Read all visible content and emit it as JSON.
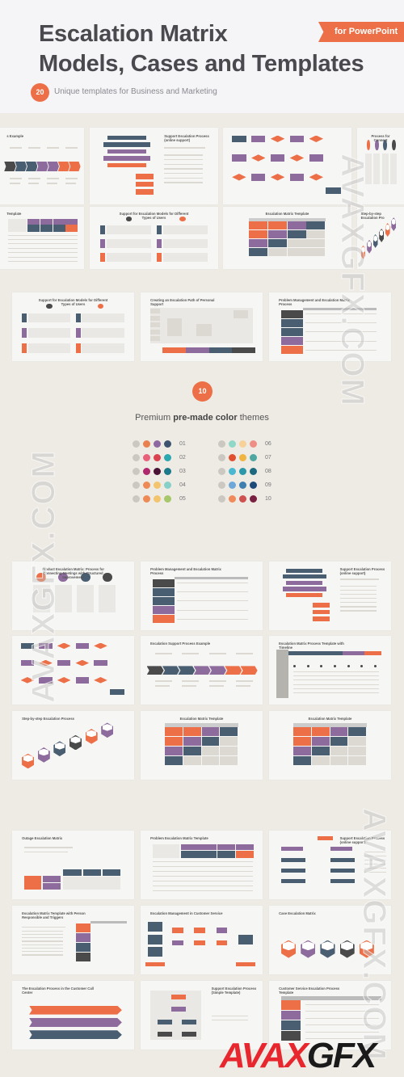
{
  "header": {
    "title_line1": "Escalation Matrix",
    "title_line2": "Models, Cases and Templates",
    "ribbon": "for PowerPoint",
    "count": "20",
    "subtitle": "Unique templates for Business and Marketing"
  },
  "colors": {
    "accent": "#ec6f47",
    "purple": "#8d6b9c",
    "navy": "#4a5e72",
    "dark": "#4a4a4a",
    "gray": "#d9d6cf",
    "background": "#eeebe5"
  },
  "top_strip": [
    "s Example",
    "Support Escalation Process (online support)",
    "",
    "Process for Connect",
    "Template",
    "Support for Escalation Models for Different Types of Users",
    "Escalation Matrix Template",
    "Step-by-step Escalation Pro"
  ],
  "row_three": [
    "Support for Escalation Models for Different Types of Users",
    "Creating an Escalation Path of Personal Support",
    "Problem Management and Escalation Matrix Process"
  ],
  "themes": {
    "count": "10",
    "title_pre": "Premium ",
    "title_bold": "pre-made color",
    "title_post": " themes",
    "items": [
      {
        "label": "01",
        "colors": [
          "#cbc8c2",
          "#e8804f",
          "#8e68a0",
          "#3d5370"
        ]
      },
      {
        "label": "02",
        "colors": [
          "#cbc8c2",
          "#e8607a",
          "#d9424e",
          "#2aa8b0"
        ]
      },
      {
        "label": "03",
        "colors": [
          "#cbc8c2",
          "#b0286e",
          "#4a1235",
          "#1d7a8a"
        ]
      },
      {
        "label": "04",
        "colors": [
          "#cbc8c2",
          "#ee8a55",
          "#f3c46e",
          "#86d0c8"
        ]
      },
      {
        "label": "05",
        "colors": [
          "#cbc8c2",
          "#ee8a55",
          "#f3c46e",
          "#a6c76a"
        ]
      },
      {
        "label": "06",
        "colors": [
          "#cbc8c2",
          "#8fd8c8",
          "#f6d29a",
          "#ee8f86"
        ]
      },
      {
        "label": "07",
        "colors": [
          "#cbc8c2",
          "#e0502e",
          "#f0b440",
          "#4ea8a0"
        ]
      },
      {
        "label": "08",
        "colors": [
          "#cbc8c2",
          "#4ab8d0",
          "#2a98a8",
          "#1d6a80"
        ]
      },
      {
        "label": "09",
        "colors": [
          "#cbc8c2",
          "#6fa8d8",
          "#3f7eb0",
          "#1d4a78"
        ]
      },
      {
        "label": "10",
        "colors": [
          "#cbc8c2",
          "#f08a5a",
          "#d05050",
          "#7a2040"
        ]
      }
    ]
  },
  "section_two": [
    "Product Escalation Matrix: Process for Connecting Meetings with Structured Improvement",
    "Problem Management and Escalation Matrix Process",
    "Support Escalation Process (online support)",
    "",
    "Escalation Support Process Example",
    "Escalation Matrix Process Template with Timeline",
    "Step-by-step Escalation Process",
    "Escalation Matrix Template",
    "Escalation Matrix Template"
  ],
  "section_three": [
    "Outage Escalation Matrix",
    "Problem Escalation Matrix Template",
    "Support Escalation Process (online support)",
    "Escalation Matrix Template with Person Responsible and Triggers",
    "Escalation Management in Customer Service",
    "Case Escalation Matrix",
    "The Escalation Process in the Customer Call Center",
    "Support Escalation Process (Simple Template)",
    "Customer Service Escalation Process Template"
  ],
  "watermark": {
    "text": "AVAXGFX.COM",
    "logo": "AVAXGFX"
  }
}
